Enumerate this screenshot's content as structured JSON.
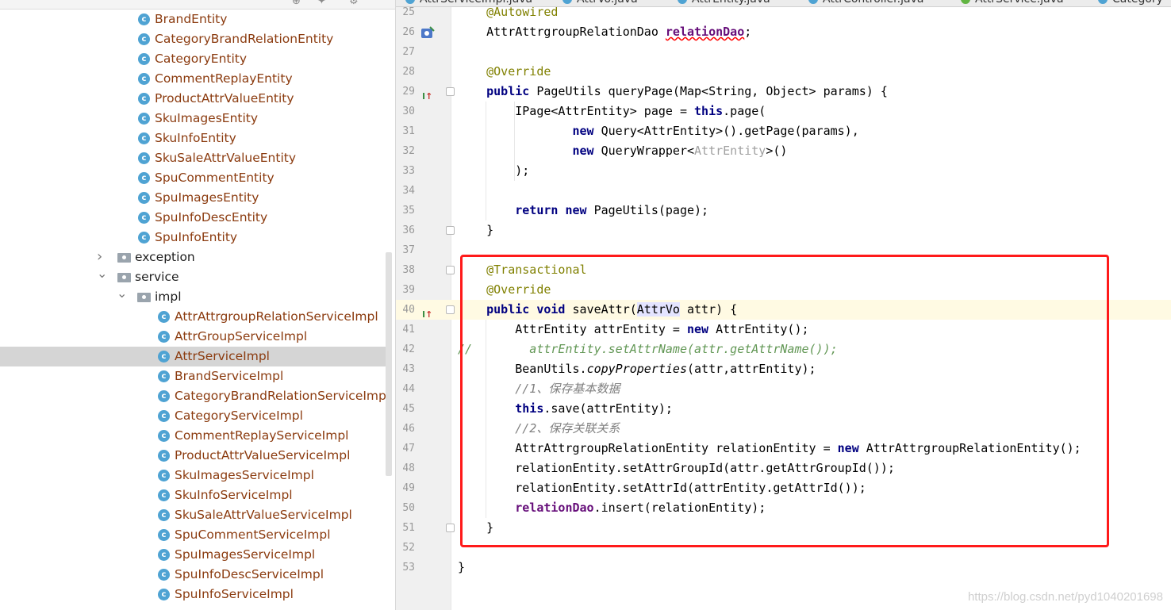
{
  "tree": {
    "rows": [
      {
        "type": "class",
        "label": "BrandEntity",
        "indent": 1
      },
      {
        "type": "class",
        "label": "CategoryBrandRelationEntity",
        "indent": 1
      },
      {
        "type": "class",
        "label": "CategoryEntity",
        "indent": 1
      },
      {
        "type": "class",
        "label": "CommentReplayEntity",
        "indent": 1
      },
      {
        "type": "class",
        "label": "ProductAttrValueEntity",
        "indent": 1
      },
      {
        "type": "class",
        "label": "SkuImagesEntity",
        "indent": 1
      },
      {
        "type": "class",
        "label": "SkuInfoEntity",
        "indent": 1
      },
      {
        "type": "class",
        "label": "SkuSaleAttrValueEntity",
        "indent": 1
      },
      {
        "type": "class",
        "label": "SpuCommentEntity",
        "indent": 1
      },
      {
        "type": "class",
        "label": "SpuImagesEntity",
        "indent": 1
      },
      {
        "type": "class",
        "label": "SpuInfoDescEntity",
        "indent": 1
      },
      {
        "type": "class",
        "label": "SpuInfoEntity",
        "indent": 1
      },
      {
        "type": "folder",
        "label": "exception",
        "indent": 0,
        "expanded": false
      },
      {
        "type": "folder",
        "label": "service",
        "indent": 0,
        "expanded": true
      },
      {
        "type": "folder",
        "label": "impl",
        "indent": 1,
        "expanded": true
      },
      {
        "type": "class",
        "label": "AttrAttrgroupRelationServiceImpl",
        "indent": 2
      },
      {
        "type": "class",
        "label": "AttrGroupServiceImpl",
        "indent": 2
      },
      {
        "type": "class",
        "label": "AttrServiceImpl",
        "indent": 2,
        "selected": true
      },
      {
        "type": "class",
        "label": "BrandServiceImpl",
        "indent": 2
      },
      {
        "type": "class",
        "label": "CategoryBrandRelationServiceImpl",
        "indent": 2
      },
      {
        "type": "class",
        "label": "CategoryServiceImpl",
        "indent": 2
      },
      {
        "type": "class",
        "label": "CommentReplayServiceImpl",
        "indent": 2
      },
      {
        "type": "class",
        "label": "ProductAttrValueServiceImpl",
        "indent": 2
      },
      {
        "type": "class",
        "label": "SkuImagesServiceImpl",
        "indent": 2
      },
      {
        "type": "class",
        "label": "SkuInfoServiceImpl",
        "indent": 2
      },
      {
        "type": "class",
        "label": "SkuSaleAttrValueServiceImpl",
        "indent": 2
      },
      {
        "type": "class",
        "label": "SpuCommentServiceImpl",
        "indent": 2
      },
      {
        "type": "class",
        "label": "SpuImagesServiceImpl",
        "indent": 2
      },
      {
        "type": "class",
        "label": "SpuInfoDescServiceImpl",
        "indent": 2
      },
      {
        "type": "class",
        "label": "SpuInfoServiceImpl",
        "indent": 2
      }
    ]
  },
  "editor": {
    "tabs": [
      {
        "label": "AttrServiceImpl.java",
        "color": "#4fa3d3"
      },
      {
        "label": "AttrVo.java",
        "color": "#4fa3d3"
      },
      {
        "label": "AttrEntity.java",
        "color": "#4fa3d3"
      },
      {
        "label": "AttrController.java",
        "color": "#4fa3d3"
      },
      {
        "label": "AttrService.java",
        "color": "#62b543"
      },
      {
        "label": "Category",
        "color": "#4fa3d3"
      }
    ],
    "lines": [
      {
        "n": "25",
        "html": "    <span class=\"ann\">@Autowired</span>"
      },
      {
        "n": "26",
        "html": "    AttrAttrgroupRelationDao <span class=\"field squig\">relationDao</span>;",
        "gutter": "bean"
      },
      {
        "n": "27",
        "html": ""
      },
      {
        "n": "28",
        "html": "    <span class=\"ann\">@Override</span>"
      },
      {
        "n": "29",
        "html": "    <span class=\"kw\">public</span> PageUtils queryPage(Map&lt;String, Object&gt; params) {",
        "gutter": "impl",
        "fold": true
      },
      {
        "n": "30",
        "html": "        IPage&lt;AttrEntity&gt; page = <span class=\"kw\">this</span>.page("
      },
      {
        "n": "31",
        "html": "                <span class=\"kw\">new</span> Query&lt;AttrEntity&gt;().getPage(params),"
      },
      {
        "n": "32",
        "html": "                <span class=\"kw\">new</span> QueryWrapper&lt;<span class=\"gen\">AttrEntity</span>&gt;()"
      },
      {
        "n": "33",
        "html": "        );"
      },
      {
        "n": "34",
        "html": ""
      },
      {
        "n": "35",
        "html": "        <span class=\"kw\">return new</span> PageUtils(page);"
      },
      {
        "n": "36",
        "html": "    }",
        "fold": true
      },
      {
        "n": "37",
        "html": ""
      },
      {
        "n": "38",
        "html": "    <span class=\"ann\">@Transactional</span>",
        "fold": true
      },
      {
        "n": "39",
        "html": "    <span class=\"ann\">@Override</span>"
      },
      {
        "n": "40",
        "html": "    <span class=\"kw\">public void</span> saveAttr(<span class=\"hlparam\">AttrVo</span> attr) {",
        "gutter": "impl",
        "fold": true,
        "current": true
      },
      {
        "n": "41",
        "html": "        AttrEntity attrEntity = <span class=\"kw\">new</span> AttrEntity();"
      },
      {
        "n": "42",
        "html": "<span class=\"gcmt\">//        attrEntity.setAttrName(attr.getAttrName());</span>"
      },
      {
        "n": "43",
        "html": "        BeanUtils.<span class=\"italic\">copyProperties</span>(attr,attrEntity);"
      },
      {
        "n": "44",
        "html": "        <span class=\"cmt\">//1、保存基本数据</span>"
      },
      {
        "n": "45",
        "html": "        <span class=\"kw\">this</span>.save(attrEntity);"
      },
      {
        "n": "46",
        "html": "        <span class=\"cmt\">//2、保存关联关系</span>"
      },
      {
        "n": "47",
        "html": "        AttrAttrgroupRelationEntity relationEntity = <span class=\"kw\">new</span> AttrAttrgroupRelationEntity();"
      },
      {
        "n": "48",
        "html": "        relationEntity.setAttrGroupId(attr.getAttrGroupId());"
      },
      {
        "n": "49",
        "html": "        relationEntity.setAttrId(attrEntity.getAttrId());"
      },
      {
        "n": "50",
        "html": "        <span class=\"field\">relationDao</span>.insert(relationEntity);"
      },
      {
        "n": "51",
        "html": "    }",
        "fold": true
      },
      {
        "n": "52",
        "html": ""
      },
      {
        "n": "53",
        "html": "}"
      }
    ]
  },
  "watermark": "https://blog.csdn.net/pyd1040201698"
}
